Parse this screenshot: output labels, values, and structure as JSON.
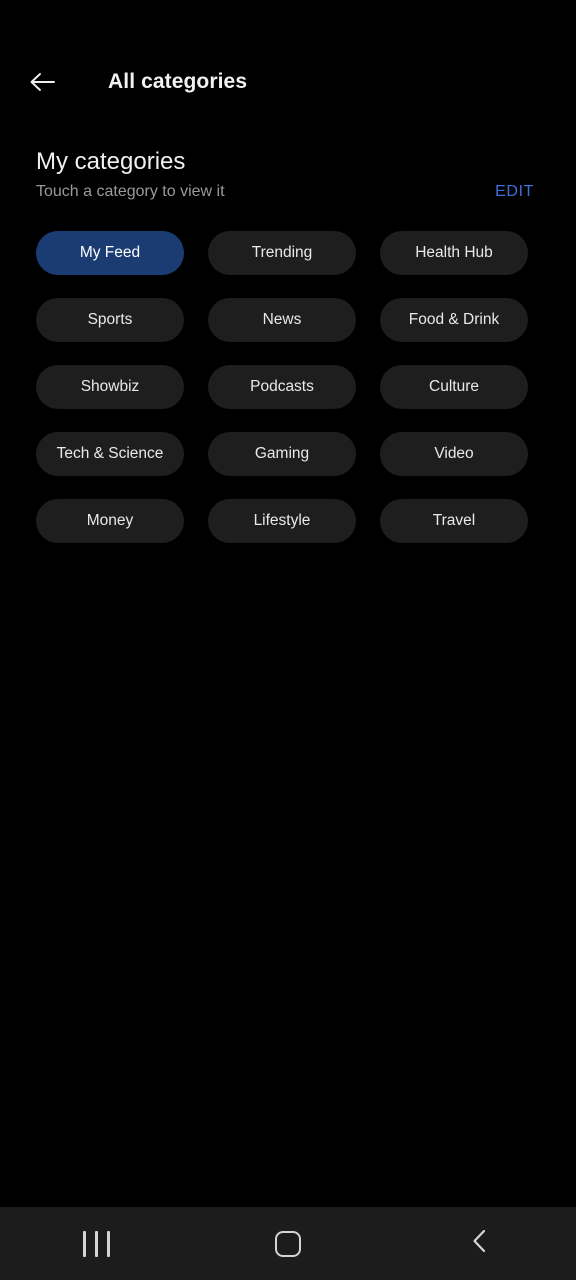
{
  "appbar": {
    "back_icon": "arrow-left-icon",
    "title": "All categories"
  },
  "section": {
    "title": "My categories",
    "subtitle": "Touch a category to view it",
    "edit_label": "EDIT",
    "edit_color": "#3f6fd8"
  },
  "categories": [
    {
      "label": "My Feed",
      "selected": true
    },
    {
      "label": "Trending",
      "selected": false
    },
    {
      "label": "Health Hub",
      "selected": false
    },
    {
      "label": "Sports",
      "selected": false
    },
    {
      "label": "News",
      "selected": false
    },
    {
      "label": "Food & Drink",
      "selected": false
    },
    {
      "label": "Showbiz",
      "selected": false
    },
    {
      "label": "Podcasts",
      "selected": false
    },
    {
      "label": "Culture",
      "selected": false
    },
    {
      "label": "Tech & Science",
      "selected": false
    },
    {
      "label": "Gaming",
      "selected": false
    },
    {
      "label": "Video",
      "selected": false
    },
    {
      "label": "Money",
      "selected": false
    },
    {
      "label": "Lifestyle",
      "selected": false
    },
    {
      "label": "Travel",
      "selected": false
    }
  ],
  "chip_colors": {
    "selected_bg": "#1b3c72",
    "unselected_bg": "#1e1e1e",
    "text": "#e9e9e9"
  },
  "navbar": {
    "background": "#1c1c1c",
    "buttons": [
      {
        "icon": "recents-icon"
      },
      {
        "icon": "home-icon"
      },
      {
        "icon": "back-chevron-icon"
      }
    ]
  }
}
